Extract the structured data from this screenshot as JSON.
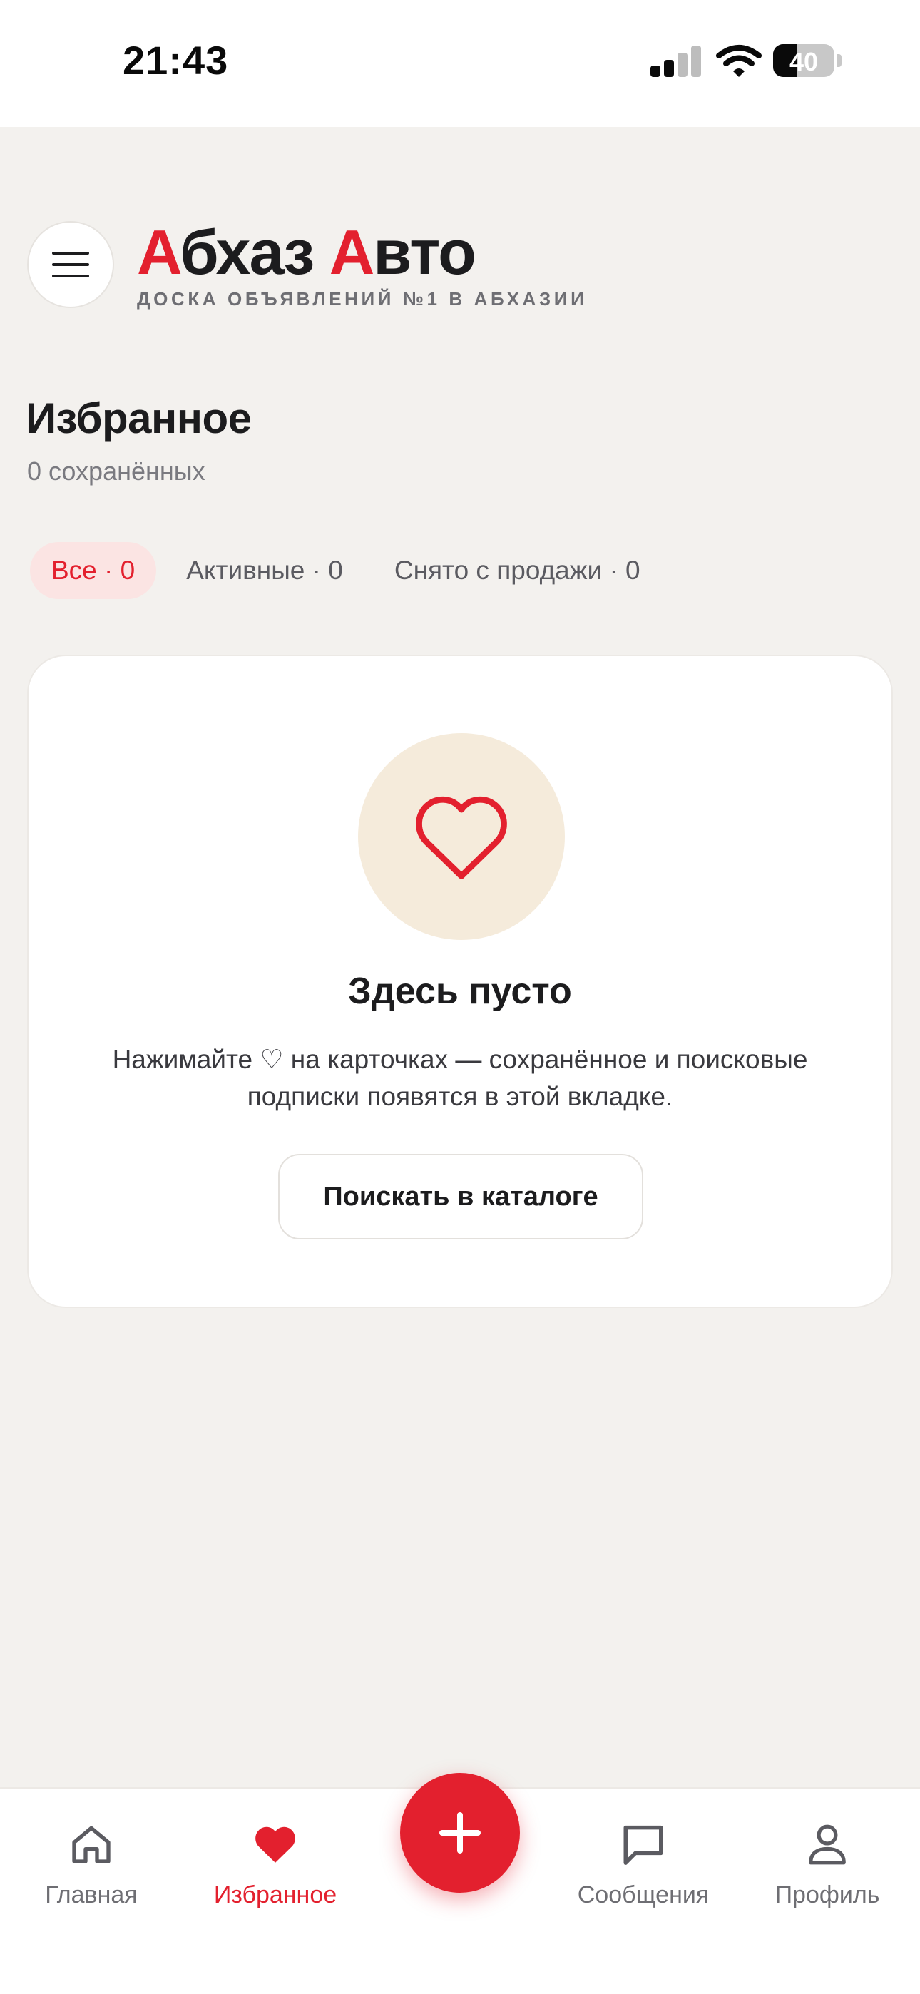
{
  "status_bar": {
    "time": "21:43",
    "battery_level": "40",
    "battery_fraction": 0.4,
    "icons": [
      "cellular-signal-icon",
      "wifi-icon",
      "battery-icon"
    ]
  },
  "header": {
    "menu_icon": "hamburger-menu-icon",
    "logo": {
      "part1_accent": "А",
      "part1_rest": "бхаз ",
      "part2_accent": "А",
      "part2_rest": "вто",
      "tagline": "ДОСКА ОБЪЯВЛЕНИЙ №1 В АБХАЗИИ"
    }
  },
  "page": {
    "title": "Избранное",
    "subtitle": "0 сохранённых"
  },
  "filters": [
    {
      "label": "Все · 0",
      "active": true
    },
    {
      "label": "Активные · 0",
      "active": false
    },
    {
      "label": "Снято с продажи · 0",
      "active": false
    }
  ],
  "empty_state": {
    "icon": "heart-outline-icon",
    "title": "Здесь пусто",
    "text": "Нажимайте ♡ на карточках — сохранённое и поисковые подписки появятся в этой вкладке.",
    "button_label": "Поискать в каталоге"
  },
  "bottom_nav": {
    "items": [
      {
        "label": "Главная",
        "icon": "home-icon",
        "active": false
      },
      {
        "label": "Избранное",
        "icon": "heart-icon",
        "active": true
      },
      {
        "label": "Сообщения",
        "icon": "chat-bubble-icon",
        "active": false
      },
      {
        "label": "Профиль",
        "icon": "user-icon",
        "active": false
      }
    ],
    "fab_icon": "plus-icon"
  },
  "colors": {
    "accent": "#E3202E",
    "background": "#F3F1EE",
    "card": "#FFFFFF",
    "chip_active_bg": "#FBE4E3",
    "empty_icon_bg": "#F5EBDB"
  }
}
